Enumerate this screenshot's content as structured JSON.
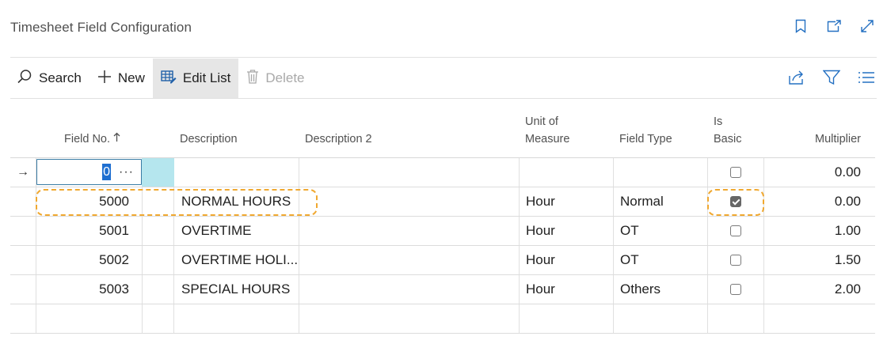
{
  "page": {
    "title": "Timesheet Field Configuration"
  },
  "header_icons": [
    "bookmark-icon",
    "open-new-window-icon",
    "expand-icon"
  ],
  "actions": {
    "search": "Search",
    "new": "New",
    "edit_list": "Edit List",
    "delete": "Delete"
  },
  "right_actions": [
    "share-icon",
    "filter-icon",
    "list-view-icon"
  ],
  "columns": {
    "field_no": "Field No.",
    "description": "Description",
    "description2": "Description 2",
    "uom_line1": "Unit of",
    "uom_line2": "Measure",
    "field_type": "Field Type",
    "is_basic_line1": "Is",
    "is_basic_line2": "Basic",
    "multiplier": "Multiplier"
  },
  "new_row": {
    "field_no": "0",
    "is_basic": false,
    "multiplier": "0.00"
  },
  "rows": [
    {
      "field_no": "5000",
      "description": "NORMAL HOURS",
      "description2": "",
      "uom": "Hour",
      "field_type": "Normal",
      "is_basic": true,
      "multiplier": "0.00"
    },
    {
      "field_no": "5001",
      "description": "OVERTIME",
      "description2": "",
      "uom": "Hour",
      "field_type": "OT",
      "is_basic": false,
      "multiplier": "1.00"
    },
    {
      "field_no": "5002",
      "description": "OVERTIME HOLI...",
      "description2": "",
      "uom": "Hour",
      "field_type": "OT",
      "is_basic": false,
      "multiplier": "1.50"
    },
    {
      "field_no": "5003",
      "description": "SPECIAL HOURS",
      "description2": "",
      "uom": "Hour",
      "field_type": "Others",
      "is_basic": false,
      "multiplier": "2.00"
    }
  ],
  "colors": {
    "accent": "#1f6fd0",
    "highlight": "#f0a830",
    "active_cell": "#b5e6ee"
  }
}
